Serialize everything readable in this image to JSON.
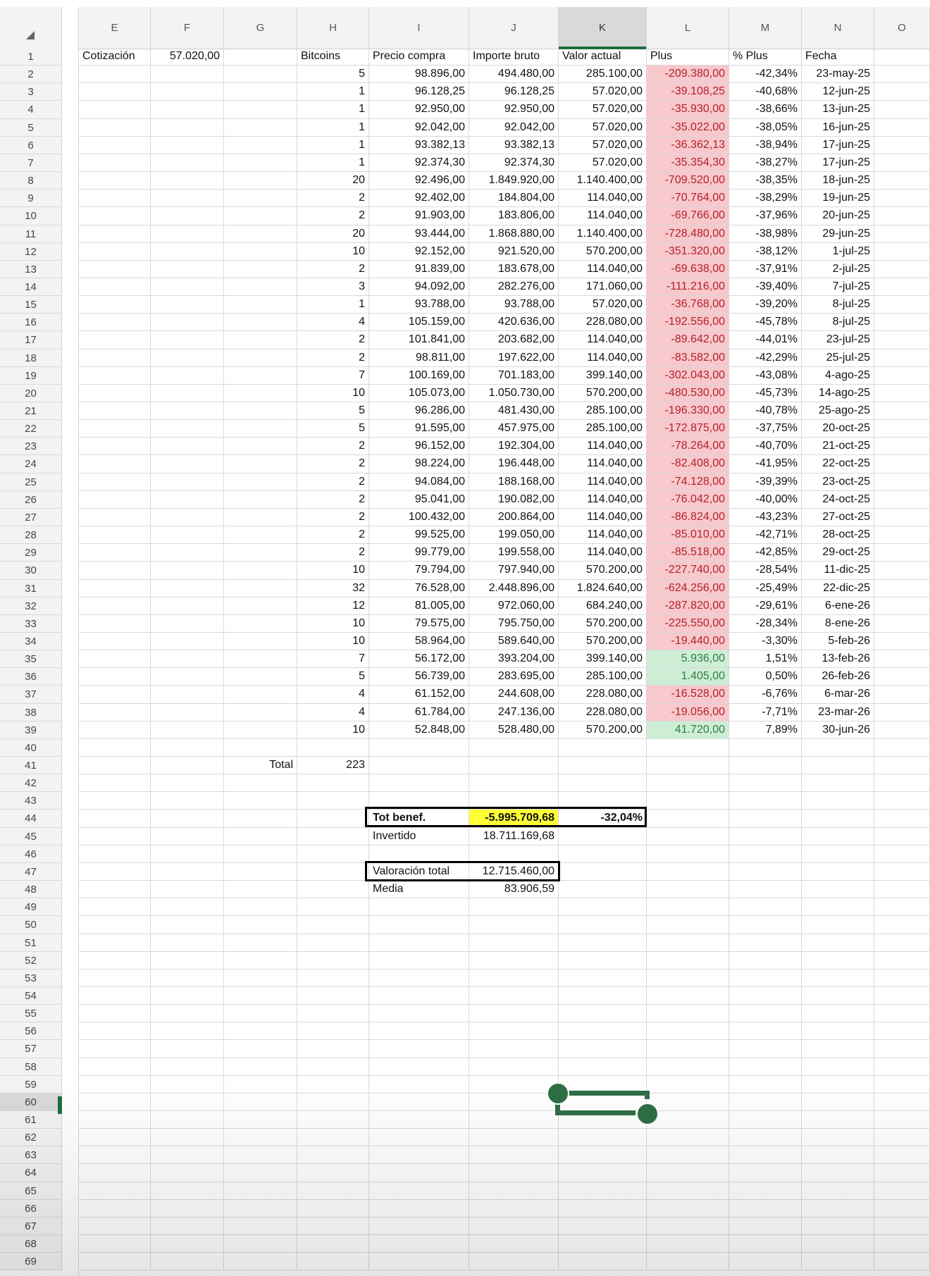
{
  "columns": [
    "E",
    "F",
    "G",
    "H",
    "I",
    "J",
    "K",
    "L",
    "M",
    "N",
    "O"
  ],
  "selected_column": "K",
  "selected_row": "60",
  "row_numbers": [
    "1",
    "2",
    "3",
    "4",
    "5",
    "6",
    "7",
    "8",
    "9",
    "10",
    "11",
    "12",
    "13",
    "14",
    "15",
    "16",
    "17",
    "18",
    "19",
    "20",
    "21",
    "22",
    "23",
    "24",
    "25",
    "26",
    "27",
    "28",
    "29",
    "30",
    "31",
    "32",
    "33",
    "34",
    "35",
    "36",
    "37",
    "38",
    "39",
    "40",
    "41",
    "42",
    "43",
    "44",
    "45",
    "46",
    "47",
    "48",
    "49",
    "50",
    "51",
    "52",
    "53",
    "54",
    "55",
    "56",
    "57",
    "58",
    "59",
    "60",
    "61",
    "62",
    "63",
    "64",
    "65",
    "66",
    "67",
    "68",
    "69"
  ],
  "cotizacion_label": "Cotización",
  "cotizacion_value": "57.020,00",
  "headers": {
    "bitcoins": "Bitcoins",
    "precio_compra": "Precio compra",
    "importe_bruto": "Importe bruto",
    "valor_actual": "Valor actual",
    "plus": "Plus",
    "pct_plus": "% Plus",
    "fecha": "Fecha"
  },
  "rows": [
    {
      "btc": "5",
      "precio": "98.896,00",
      "bruto": "494.480,00",
      "actual": "285.100,00",
      "plus": "-209.380,00",
      "pct": "-42,34%",
      "fecha": "23-may-25",
      "sign": "neg"
    },
    {
      "btc": "1",
      "precio": "96.128,25",
      "bruto": "96.128,25",
      "actual": "57.020,00",
      "plus": "-39.108,25",
      "pct": "-40,68%",
      "fecha": "12-jun-25",
      "sign": "neg"
    },
    {
      "btc": "1",
      "precio": "92.950,00",
      "bruto": "92.950,00",
      "actual": "57.020,00",
      "plus": "-35.930,00",
      "pct": "-38,66%",
      "fecha": "13-jun-25",
      "sign": "neg"
    },
    {
      "btc": "1",
      "precio": "92.042,00",
      "bruto": "92.042,00",
      "actual": "57.020,00",
      "plus": "-35.022,00",
      "pct": "-38,05%",
      "fecha": "16-jun-25",
      "sign": "neg"
    },
    {
      "btc": "1",
      "precio": "93.382,13",
      "bruto": "93.382,13",
      "actual": "57.020,00",
      "plus": "-36.362,13",
      "pct": "-38,94%",
      "fecha": "17-jun-25",
      "sign": "neg"
    },
    {
      "btc": "1",
      "precio": "92.374,30",
      "bruto": "92.374,30",
      "actual": "57.020,00",
      "plus": "-35.354,30",
      "pct": "-38,27%",
      "fecha": "17-jun-25",
      "sign": "neg"
    },
    {
      "btc": "20",
      "precio": "92.496,00",
      "bruto": "1.849.920,00",
      "actual": "1.140.400,00",
      "plus": "-709.520,00",
      "pct": "-38,35%",
      "fecha": "18-jun-25",
      "sign": "neg"
    },
    {
      "btc": "2",
      "precio": "92.402,00",
      "bruto": "184.804,00",
      "actual": "114.040,00",
      "plus": "-70.764,00",
      "pct": "-38,29%",
      "fecha": "19-jun-25",
      "sign": "neg"
    },
    {
      "btc": "2",
      "precio": "91.903,00",
      "bruto": "183.806,00",
      "actual": "114.040,00",
      "plus": "-69.766,00",
      "pct": "-37,96%",
      "fecha": "20-jun-25",
      "sign": "neg"
    },
    {
      "btc": "20",
      "precio": "93.444,00",
      "bruto": "1.868.880,00",
      "actual": "1.140.400,00",
      "plus": "-728.480,00",
      "pct": "-38,98%",
      "fecha": "29-jun-25",
      "sign": "neg"
    },
    {
      "btc": "10",
      "precio": "92.152,00",
      "bruto": "921.520,00",
      "actual": "570.200,00",
      "plus": "-351.320,00",
      "pct": "-38,12%",
      "fecha": "1-jul-25",
      "sign": "neg"
    },
    {
      "btc": "2",
      "precio": "91.839,00",
      "bruto": "183.678,00",
      "actual": "114.040,00",
      "plus": "-69.638,00",
      "pct": "-37,91%",
      "fecha": "2-jul-25",
      "sign": "neg"
    },
    {
      "btc": "3",
      "precio": "94.092,00",
      "bruto": "282.276,00",
      "actual": "171.060,00",
      "plus": "-111.216,00",
      "pct": "-39,40%",
      "fecha": "7-jul-25",
      "sign": "neg"
    },
    {
      "btc": "1",
      "precio": "93.788,00",
      "bruto": "93.788,00",
      "actual": "57.020,00",
      "plus": "-36.768,00",
      "pct": "-39,20%",
      "fecha": "8-jul-25",
      "sign": "neg"
    },
    {
      "btc": "4",
      "precio": "105.159,00",
      "bruto": "420.636,00",
      "actual": "228.080,00",
      "plus": "-192.556,00",
      "pct": "-45,78%",
      "fecha": "8-jul-25",
      "sign": "neg"
    },
    {
      "btc": "2",
      "precio": "101.841,00",
      "bruto": "203.682,00",
      "actual": "114.040,00",
      "plus": "-89.642,00",
      "pct": "-44,01%",
      "fecha": "23-jul-25",
      "sign": "neg"
    },
    {
      "btc": "2",
      "precio": "98.811,00",
      "bruto": "197.622,00",
      "actual": "114.040,00",
      "plus": "-83.582,00",
      "pct": "-42,29%",
      "fecha": "25-jul-25",
      "sign": "neg"
    },
    {
      "btc": "7",
      "precio": "100.169,00",
      "bruto": "701.183,00",
      "actual": "399.140,00",
      "plus": "-302.043,00",
      "pct": "-43,08%",
      "fecha": "4-ago-25",
      "sign": "neg"
    },
    {
      "btc": "10",
      "precio": "105.073,00",
      "bruto": "1.050.730,00",
      "actual": "570.200,00",
      "plus": "-480.530,00",
      "pct": "-45,73%",
      "fecha": "14-ago-25",
      "sign": "neg"
    },
    {
      "btc": "5",
      "precio": "96.286,00",
      "bruto": "481.430,00",
      "actual": "285.100,00",
      "plus": "-196.330,00",
      "pct": "-40,78%",
      "fecha": "25-ago-25",
      "sign": "neg"
    },
    {
      "btc": "5",
      "precio": "91.595,00",
      "bruto": "457.975,00",
      "actual": "285.100,00",
      "plus": "-172.875,00",
      "pct": "-37,75%",
      "fecha": "20-oct-25",
      "sign": "neg"
    },
    {
      "btc": "2",
      "precio": "96.152,00",
      "bruto": "192.304,00",
      "actual": "114.040,00",
      "plus": "-78.264,00",
      "pct": "-40,70%",
      "fecha": "21-oct-25",
      "sign": "neg"
    },
    {
      "btc": "2",
      "precio": "98.224,00",
      "bruto": "196.448,00",
      "actual": "114.040,00",
      "plus": "-82.408,00",
      "pct": "-41,95%",
      "fecha": "22-oct-25",
      "sign": "neg"
    },
    {
      "btc": "2",
      "precio": "94.084,00",
      "bruto": "188.168,00",
      "actual": "114.040,00",
      "plus": "-74.128,00",
      "pct": "-39,39%",
      "fecha": "23-oct-25",
      "sign": "neg"
    },
    {
      "btc": "2",
      "precio": "95.041,00",
      "bruto": "190.082,00",
      "actual": "114.040,00",
      "plus": "-76.042,00",
      "pct": "-40,00%",
      "fecha": "24-oct-25",
      "sign": "neg"
    },
    {
      "btc": "2",
      "precio": "100.432,00",
      "bruto": "200.864,00",
      "actual": "114.040,00",
      "plus": "-86.824,00",
      "pct": "-43,23%",
      "fecha": "27-oct-25",
      "sign": "neg"
    },
    {
      "btc": "2",
      "precio": "99.525,00",
      "bruto": "199.050,00",
      "actual": "114.040,00",
      "plus": "-85.010,00",
      "pct": "-42,71%",
      "fecha": "28-oct-25",
      "sign": "neg"
    },
    {
      "btc": "2",
      "precio": "99.779,00",
      "bruto": "199.558,00",
      "actual": "114.040,00",
      "plus": "-85.518,00",
      "pct": "-42,85%",
      "fecha": "29-oct-25",
      "sign": "neg"
    },
    {
      "btc": "10",
      "precio": "79.794,00",
      "bruto": "797.940,00",
      "actual": "570.200,00",
      "plus": "-227.740,00",
      "pct": "-28,54%",
      "fecha": "11-dic-25",
      "sign": "neg"
    },
    {
      "btc": "32",
      "precio": "76.528,00",
      "bruto": "2.448.896,00",
      "actual": "1.824.640,00",
      "plus": "-624.256,00",
      "pct": "-25,49%",
      "fecha": "22-dic-25",
      "sign": "neg"
    },
    {
      "btc": "12",
      "precio": "81.005,00",
      "bruto": "972.060,00",
      "actual": "684.240,00",
      "plus": "-287.820,00",
      "pct": "-29,61%",
      "fecha": "6-ene-26",
      "sign": "neg"
    },
    {
      "btc": "10",
      "precio": "79.575,00",
      "bruto": "795.750,00",
      "actual": "570.200,00",
      "plus": "-225.550,00",
      "pct": "-28,34%",
      "fecha": "8-ene-26",
      "sign": "neg"
    },
    {
      "btc": "10",
      "precio": "58.964,00",
      "bruto": "589.640,00",
      "actual": "570.200,00",
      "plus": "-19.440,00",
      "pct": "-3,30%",
      "fecha": "5-feb-26",
      "sign": "neg"
    },
    {
      "btc": "7",
      "precio": "56.172,00",
      "bruto": "393.204,00",
      "actual": "399.140,00",
      "plus": "5.936,00",
      "pct": "1,51%",
      "fecha": "13-feb-26",
      "sign": "pos"
    },
    {
      "btc": "5",
      "precio": "56.739,00",
      "bruto": "283.695,00",
      "actual": "285.100,00",
      "plus": "1.405,00",
      "pct": "0,50%",
      "fecha": "26-feb-26",
      "sign": "pos"
    },
    {
      "btc": "4",
      "precio": "61.152,00",
      "bruto": "244.608,00",
      "actual": "228.080,00",
      "plus": "-16.528,00",
      "pct": "-6,76%",
      "fecha": "6-mar-26",
      "sign": "neg"
    },
    {
      "btc": "4",
      "precio": "61.784,00",
      "bruto": "247.136,00",
      "actual": "228.080,00",
      "plus": "-19.056,00",
      "pct": "-7,71%",
      "fecha": "23-mar-26",
      "sign": "neg"
    },
    {
      "btc": "10",
      "precio": "52.848,00",
      "bruto": "528.480,00",
      "actual": "570.200,00",
      "plus": "41.720,00",
      "pct": "7,89%",
      "fecha": "30-jun-26",
      "sign": "pos"
    }
  ],
  "total_label": "Total",
  "total_value": "223",
  "tot_benef_label": "Tot benef.",
  "tot_benef_value": "-5.995.709,68",
  "tot_benef_pct": "-32,04%",
  "invertido_label": "Invertido",
  "invertido_value": "18.711.169,68",
  "valoracion_label": "Valoración total",
  "valoracion_value": "12.715.460,00",
  "media_label": "Media",
  "media_value": "83.906,59",
  "colors": {
    "accent": "#1e6f3d",
    "neg_fill": "#f7c8cc",
    "neg_text": "#b3212b",
    "pos_fill": "#cdeed5",
    "pos_text": "#2e7d43",
    "highlight": "#ffff38"
  },
  "icons": {
    "corner": "select-all-triangle-icon",
    "handle": "selection-handle-icon"
  }
}
